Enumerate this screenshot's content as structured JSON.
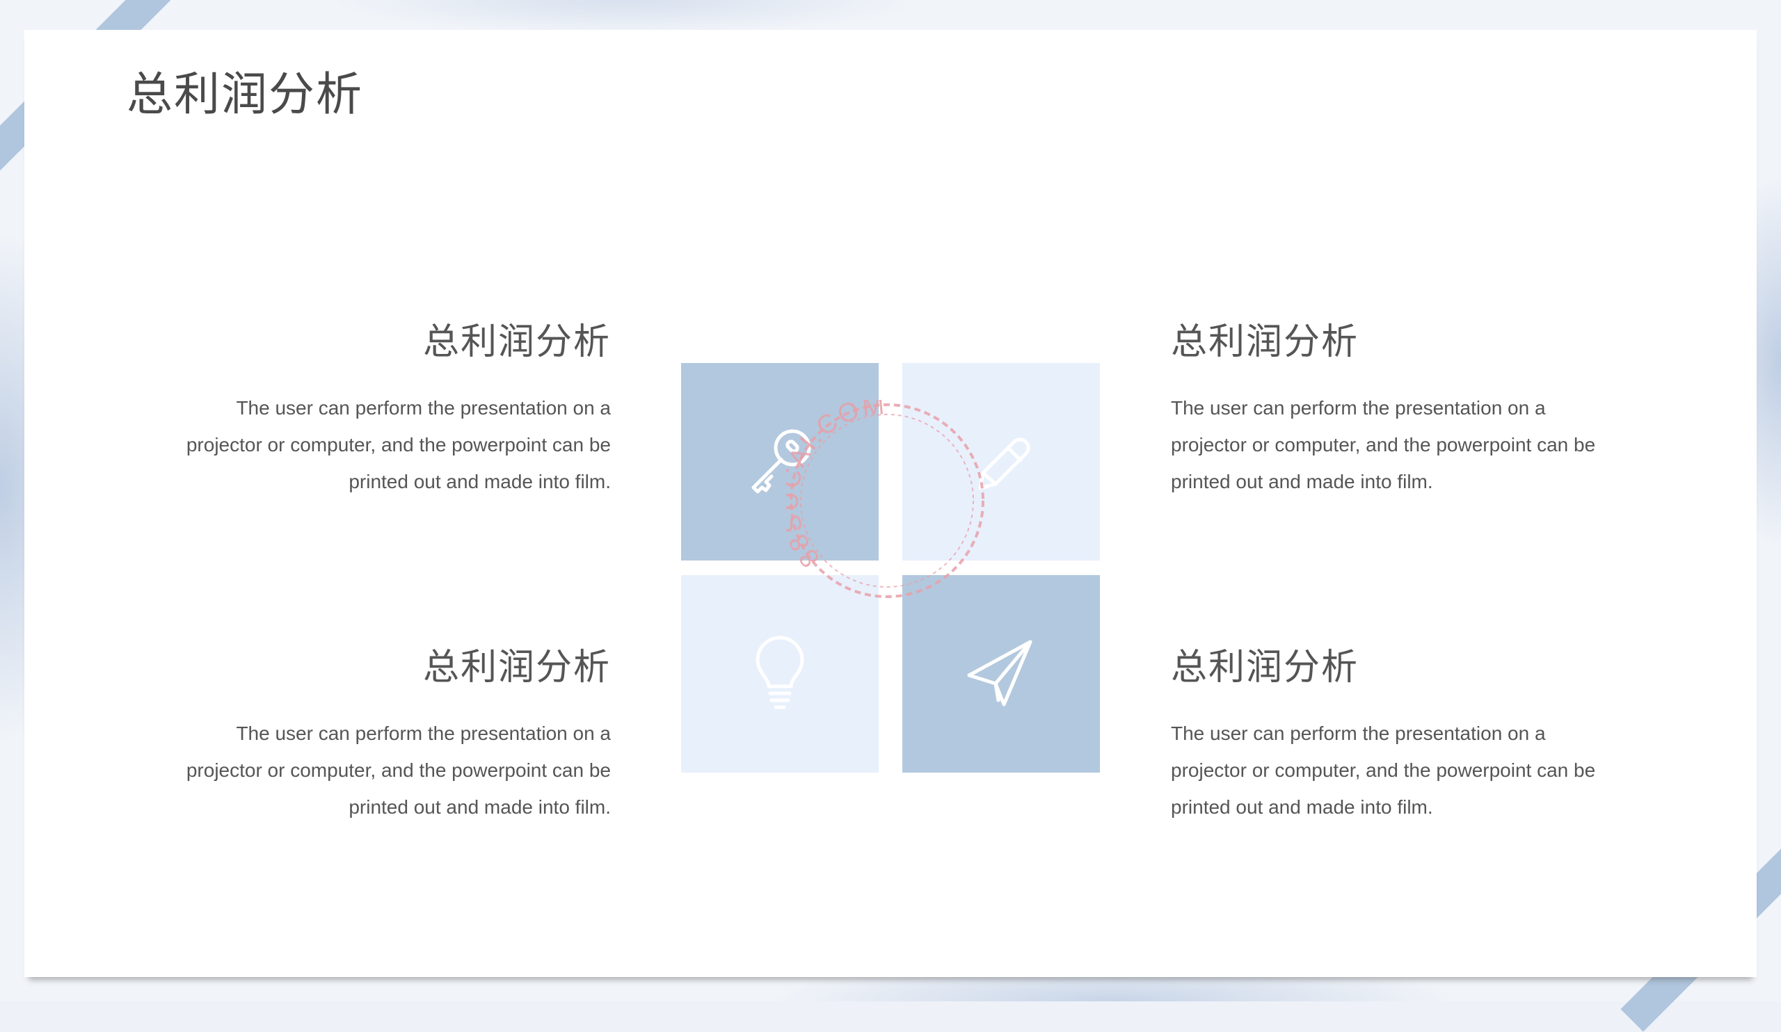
{
  "page": {
    "title": "总利润分析"
  },
  "sections": [
    {
      "position": "top-left",
      "title": "总利润分析",
      "body": "The user can perform the presentation on a projector or computer, and the powerpoint can be printed out and made into film."
    },
    {
      "position": "top-right",
      "title": "总利润分析",
      "body": "The user can perform the presentation on a projector or computer, and the powerpoint can be printed out and made into film."
    },
    {
      "position": "bottom-left",
      "title": "总利润分析",
      "body": "The user can perform the presentation on a projector or computer, and the powerpoint can be printed out and made into film."
    },
    {
      "position": "bottom-right",
      "title": "总利润分析",
      "body": "The user can perform the presentation on a projector or computer, and the powerpoint can be printed out and made into film."
    }
  ],
  "tiles": [
    {
      "icon": "key-icon",
      "shade": "dark"
    },
    {
      "icon": "pencil-icon",
      "shade": "light"
    },
    {
      "icon": "lightbulb-icon",
      "shade": "light"
    },
    {
      "icon": "paper-plane-icon",
      "shade": "dark"
    }
  ],
  "watermark": {
    "text": "88SUCAI.COM"
  },
  "colors": {
    "tile_dark": "#b2c8de",
    "tile_light": "#e8f0fc",
    "ribbon": "#b0c6de",
    "text": "#555555",
    "watermark": "#e8a0a8"
  }
}
